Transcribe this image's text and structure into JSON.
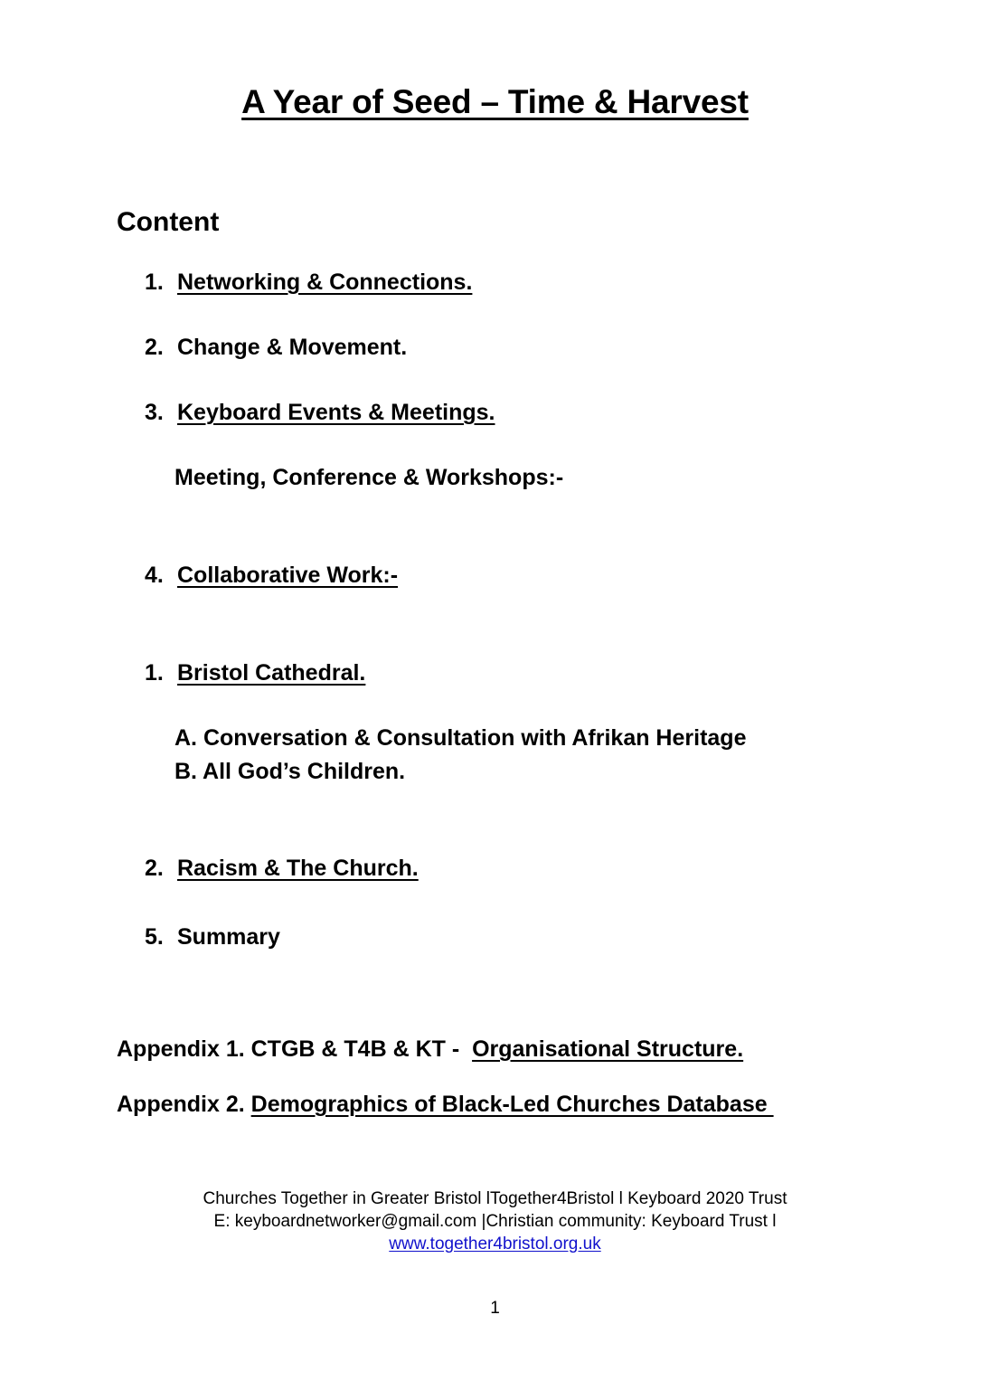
{
  "document": {
    "title": "A Year of Seed – Time & Harvest",
    "heading": "Content",
    "page_number": "1"
  },
  "contents": {
    "item1_num": "1.",
    "item1_text": "Networking & Connections.",
    "item2_num": "2.",
    "item2_text": "Change & Movement.",
    "item3_num": "3.",
    "item3_text": "Keyboard Events & Meetings.",
    "item3_sub": "Meeting, Conference & Workshops:-",
    "item4_num": "4.",
    "item4_text": "Collaborative Work:-",
    "item5_num": "1.",
    "item5_text": "Bristol Cathedral.",
    "item5_subA": "A. Conversation & Consultation with Afrikan Heritage",
    "item5_subB": "B. All God’s Children.",
    "item6_num": "2.",
    "item6_text": "Racism & The Church.",
    "item7_num": "5.",
    "item7_text": "Summary"
  },
  "appendices": {
    "appendix1_prefix": "Appendix 1. CTGB & T4B & KT -  ",
    "appendix1_underlined": "Organisational Structure.",
    "appendix2_prefix": "Appendix 2. ",
    "appendix2_underlined": "Demographics of Black-Led Churches Database "
  },
  "footer": {
    "line1": "Churches Together in Greater Bristol lTogether4Bristol l Keyboard 2020 Trust",
    "line2": "E: keyboardnetworker@gmail.com |Christian community: Keyboard Trust l",
    "link": "www.together4bristol.org.uk",
    "link_color": "#1111cc"
  }
}
